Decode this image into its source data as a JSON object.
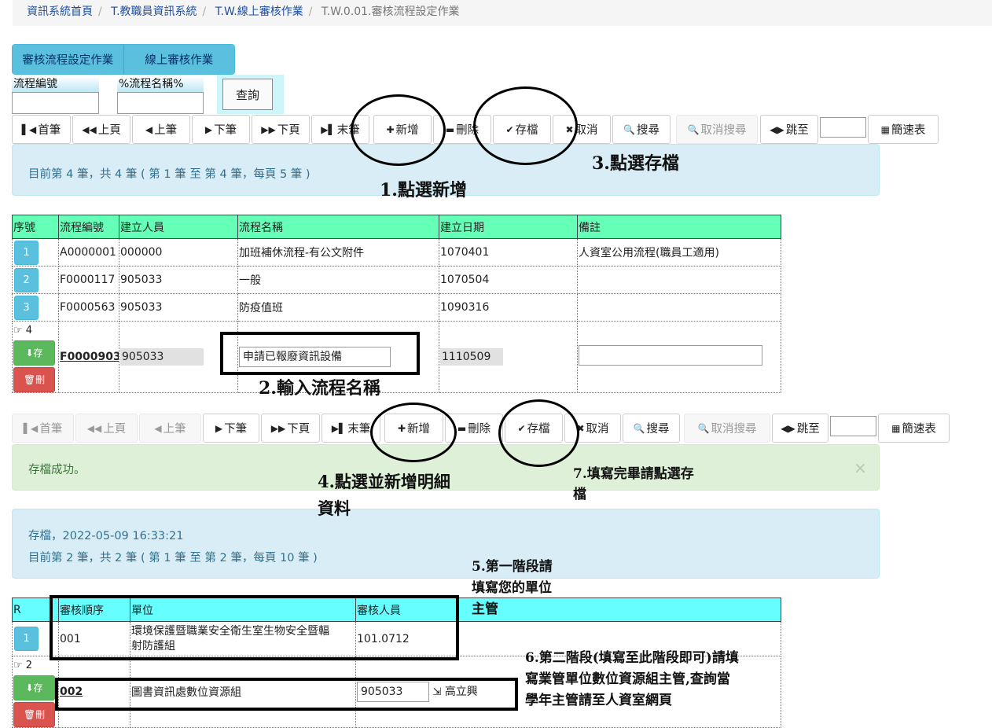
{
  "breadcrumb": [
    "資訊系統首頁",
    "T.教職員資訊系統",
    "T.W.線上審核作業",
    "T.W.0.01.審核流程設定作業"
  ],
  "tabs": [
    "審核流程設定作業",
    "線上審核作業"
  ],
  "filters": {
    "code_label": "流程編號",
    "name_label": "%流程名稱%",
    "query_btn": "查詢"
  },
  "toolbar1": [
    "首筆",
    "上頁",
    "上筆",
    "下筆",
    "下頁",
    "末筆",
    "新增",
    "刪除",
    "存檔",
    "取消",
    "搜尋",
    "取消搜尋",
    "跳至",
    "簡速表"
  ],
  "info1": "目前第 4 筆，共 4 筆 ( 第 1 筆 至 第 4 筆，每頁 5 筆 )",
  "table1": {
    "headers": [
      "序號",
      "流程編號",
      "建立人員",
      "流程名稱",
      "建立日期",
      "備註"
    ],
    "rows": [
      {
        "no": "1",
        "code": "A0000001",
        "creator": "000000",
        "name": "加班補休流程-有公文附件",
        "date": "1070401",
        "note": "人資室公用流程(職員工適用)"
      },
      {
        "no": "2",
        "code": "F0000117",
        "creator": "905033",
        "name": "一般",
        "date": "1070504",
        "note": ""
      },
      {
        "no": "3",
        "code": "F0000563",
        "creator": "905033",
        "name": "防疫值班",
        "date": "1090316",
        "note": ""
      }
    ],
    "edit_row": {
      "pointer": "4",
      "save": "存",
      "del": "刪",
      "code": "F0000903",
      "creator": "905033",
      "name": "申請已報廢資訊設備",
      "date": "1110509",
      "note": ""
    }
  },
  "toolbar2": [
    "首筆",
    "上頁",
    "上筆",
    "下筆",
    "下頁",
    "末筆",
    "新增",
    "刪除",
    "存檔",
    "取消",
    "搜尋",
    "取消搜尋",
    "跳至",
    "簡速表"
  ],
  "success_msg": "存檔成功。",
  "close_x": "×",
  "info2": {
    "line1": "存檔，2022-05-09 16:33:21",
    "line2": "目前第 2 筆，共 2 筆 ( 第 1 筆 至 第 2 筆，每頁 10 筆 )"
  },
  "table2": {
    "headers": [
      "R",
      "審核順序",
      "單位",
      "審核人員"
    ],
    "rows": [
      {
        "no": "1",
        "order": "001",
        "unit_l1": "環境保護暨職業安全衛生室生物安全暨輻",
        "unit_l2": "射防護組",
        "reviewer": "101.0712"
      }
    ],
    "edit_row": {
      "pointer": "2",
      "save": "存",
      "del": "刪",
      "order": "002",
      "unit": "圖書資訊處數位資源組",
      "reviewer_id": "905033",
      "reviewer_name": "高立興"
    }
  },
  "annotations": {
    "a1": "1.點選新增",
    "a2": "2.輸入流程名稱",
    "a3": "3.點選存檔",
    "a4_l1": "4.點選並新增明細",
    "a4_l2": "資料",
    "a5_l1": "5.第一階段請",
    "a5_l2": "填寫您的單位",
    "a5_l3": "主管",
    "a6_l1": "6.第二階段(填寫至此階段即可)請填",
    "a6_l2": "寫業管單位數位資源組主管,查詢當",
    "a6_l3": "學年主管請至人資室網頁",
    "a7_l1": "7.填寫完畢請點選存",
    "a7_l2": "檔"
  }
}
